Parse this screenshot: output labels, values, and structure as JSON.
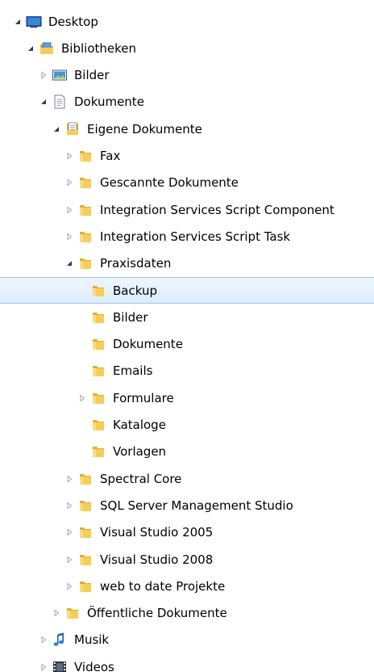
{
  "colors": {
    "selection_fill_top": "#eef6fd",
    "selection_fill_bottom": "#dcecfb",
    "selection_border": "#99c9ef",
    "folder_yellow": "#f3c64d",
    "arrow_gray": "#a6a6a6"
  },
  "tree": [
    {
      "label": "Desktop",
      "depth": 0,
      "state": "expanded",
      "icon": "desktop-icon"
    },
    {
      "label": "Bibliotheken",
      "depth": 1,
      "state": "expanded",
      "icon": "libraries-icon"
    },
    {
      "label": "Bilder",
      "depth": 2,
      "state": "collapsed",
      "icon": "pictures-library-icon"
    },
    {
      "label": "Dokumente",
      "depth": 2,
      "state": "expanded",
      "icon": "documents-library-icon"
    },
    {
      "label": "Eigene Dokumente",
      "depth": 3,
      "state": "expanded",
      "icon": "document-folder-icon"
    },
    {
      "label": "Fax",
      "depth": 4,
      "state": "collapsed",
      "icon": "folder-icon"
    },
    {
      "label": "Gescannte Dokumente",
      "depth": 4,
      "state": "collapsed",
      "icon": "folder-icon"
    },
    {
      "label": "Integration Services Script Component",
      "depth": 4,
      "state": "collapsed",
      "icon": "folder-icon"
    },
    {
      "label": "Integration Services Script Task",
      "depth": 4,
      "state": "collapsed",
      "icon": "folder-icon"
    },
    {
      "label": "Praxisdaten",
      "depth": 4,
      "state": "expanded",
      "icon": "folder-icon"
    },
    {
      "label": "Backup",
      "depth": 5,
      "state": "leaf",
      "icon": "folder-icon",
      "selected": true
    },
    {
      "label": "Bilder",
      "depth": 5,
      "state": "leaf",
      "icon": "folder-icon"
    },
    {
      "label": "Dokumente",
      "depth": 5,
      "state": "leaf",
      "icon": "folder-icon"
    },
    {
      "label": "Emails",
      "depth": 5,
      "state": "leaf",
      "icon": "folder-icon"
    },
    {
      "label": "Formulare",
      "depth": 5,
      "state": "collapsed",
      "icon": "folder-icon"
    },
    {
      "label": "Kataloge",
      "depth": 5,
      "state": "leaf",
      "icon": "folder-icon"
    },
    {
      "label": "Vorlagen",
      "depth": 5,
      "state": "leaf",
      "icon": "folder-icon"
    },
    {
      "label": "Spectral Core",
      "depth": 4,
      "state": "collapsed",
      "icon": "folder-icon"
    },
    {
      "label": "SQL Server Management Studio",
      "depth": 4,
      "state": "collapsed",
      "icon": "folder-icon"
    },
    {
      "label": "Visual Studio 2005",
      "depth": 4,
      "state": "collapsed",
      "icon": "folder-icon"
    },
    {
      "label": "Visual Studio 2008",
      "depth": 4,
      "state": "collapsed",
      "icon": "folder-icon"
    },
    {
      "label": "web to date Projekte",
      "depth": 4,
      "state": "collapsed",
      "icon": "folder-icon"
    },
    {
      "label": "Öffentliche Dokumente",
      "depth": 3,
      "state": "collapsed",
      "icon": "folder-icon"
    },
    {
      "label": "Musik",
      "depth": 2,
      "state": "collapsed",
      "icon": "music-library-icon"
    },
    {
      "label": "Videos",
      "depth": 2,
      "state": "collapsed",
      "icon": "videos-library-icon"
    }
  ]
}
